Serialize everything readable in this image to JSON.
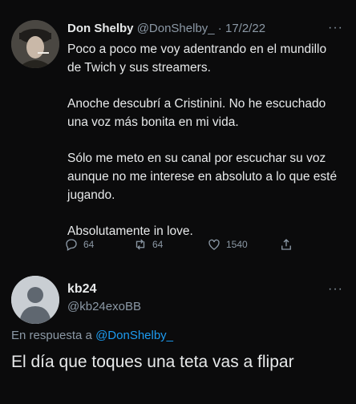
{
  "tweet": {
    "name": "Don Shelby",
    "handle": "@DonShelby_",
    "separator": " · ",
    "date": "17/2/22",
    "more": "···",
    "paragraphs": [
      "Poco a poco me voy adentrando en el mundillo de Twich y sus streamers.",
      "Anoche descubrí a Cristinini. No he escuchado una voz más bonita en mi vida.",
      "Sólo me meto en su canal por escuchar su voz aunque no me interese en absoluto a lo que esté jugando.",
      "Absolutamente in love."
    ],
    "stats": {
      "replies": "64",
      "retweets": "64",
      "likes": "1540"
    }
  },
  "reply": {
    "name": "kb24",
    "handle": "@kb24exoBB",
    "more": "···",
    "in_reply_prefix": "En respuesta a ",
    "in_reply_handle": "@DonShelby_",
    "text": "El día que toques una teta vas a flipar"
  },
  "icons": [
    "reply-icon",
    "retweet-icon",
    "like-icon",
    "share-icon"
  ],
  "colors": {
    "background": "#0b0b0c",
    "text": "#e7e9ea",
    "muted": "#8b98a5",
    "link": "#1d9bf0"
  }
}
